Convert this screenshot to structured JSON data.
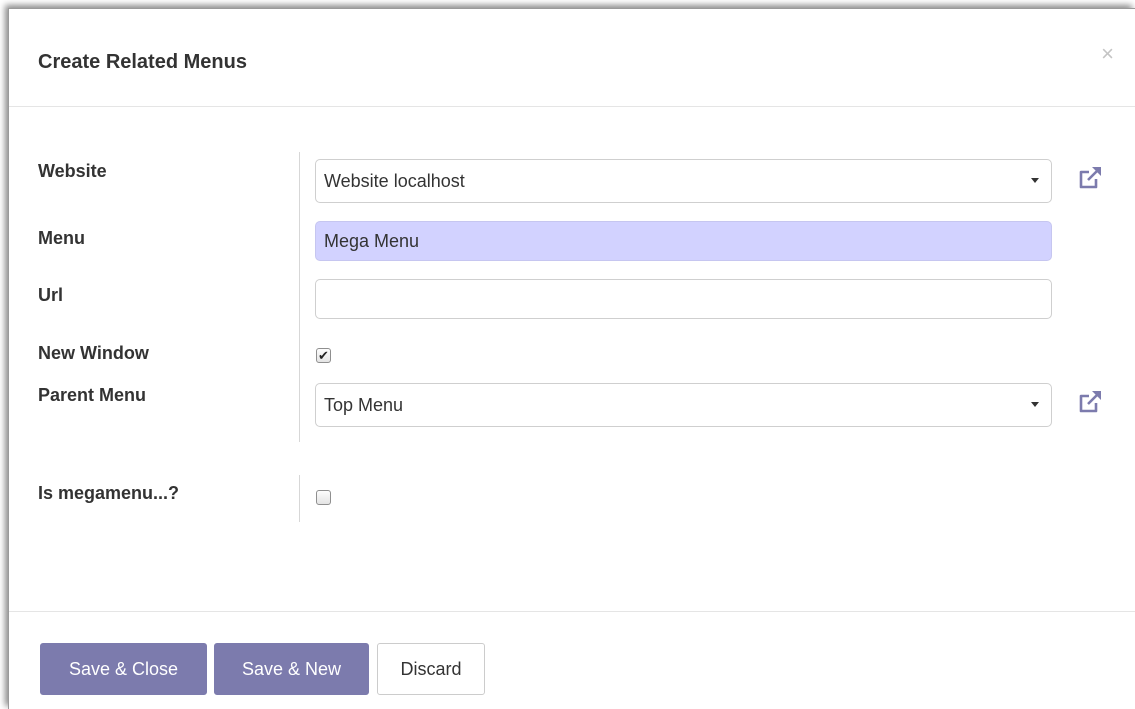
{
  "dialog": {
    "title": "Create Related Menus",
    "close_symbol": "×"
  },
  "form": {
    "website": {
      "label": "Website",
      "value": "Website localhost",
      "icon": "external-link-icon"
    },
    "menu": {
      "label": "Menu",
      "value": "Mega Menu"
    },
    "url": {
      "label": "Url",
      "value": ""
    },
    "new_window": {
      "label": "New Window",
      "checked": true,
      "mark": "✔"
    },
    "parent_menu": {
      "label": "Parent Menu",
      "value": "Top Menu",
      "icon": "external-link-icon"
    },
    "is_megamenu": {
      "label": "Is megamenu...?",
      "checked": false
    }
  },
  "footer": {
    "save_close_label": "Save & Close",
    "save_new_label": "Save & New",
    "discard_label": "Discard"
  },
  "colors": {
    "primary": "#7c7bad",
    "required_field": "#d2d2ff",
    "external_link_icon": "#7c7bad"
  }
}
